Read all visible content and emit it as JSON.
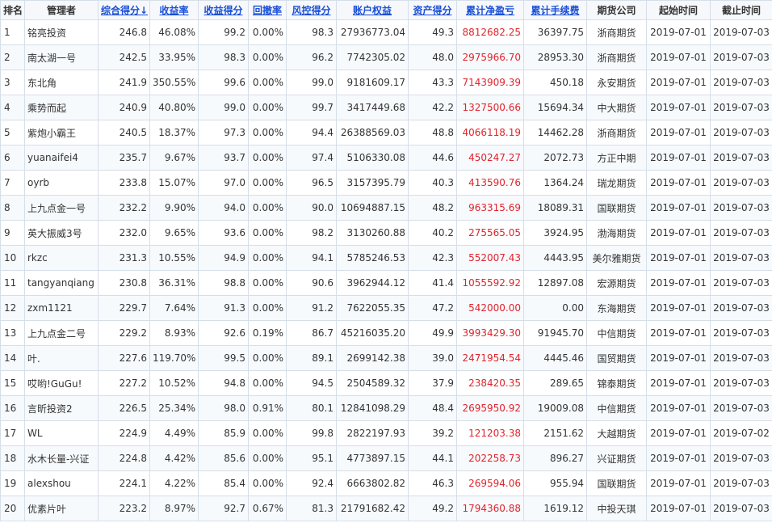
{
  "headers": [
    {
      "label": "排名",
      "sortable": false
    },
    {
      "label": "管理者",
      "sortable": false
    },
    {
      "label": "综合得分↓",
      "sortable": true
    },
    {
      "label": "收益率",
      "sortable": true
    },
    {
      "label": "收益得分",
      "sortable": true
    },
    {
      "label": "回撤率",
      "sortable": true
    },
    {
      "label": "风控得分",
      "sortable": true
    },
    {
      "label": "账户权益",
      "sortable": true
    },
    {
      "label": "资产得分",
      "sortable": true
    },
    {
      "label": "累计净盈亏",
      "sortable": true
    },
    {
      "label": "累计手续费",
      "sortable": true
    },
    {
      "label": "期货公司",
      "sortable": false
    },
    {
      "label": "起始时间",
      "sortable": false
    },
    {
      "label": "截止时间",
      "sortable": false
    }
  ],
  "rows": [
    [
      "1",
      "铭亮投资",
      "246.8",
      "46.08%",
      "99.2",
      "0.00%",
      "98.3",
      "27936773.04",
      "49.3",
      "8812682.25",
      "36397.75",
      "浙商期货",
      "2019-07-01",
      "2019-07-03"
    ],
    [
      "2",
      "南太湖一号",
      "242.5",
      "33.95%",
      "98.3",
      "0.00%",
      "96.2",
      "7742305.02",
      "48.0",
      "2975966.70",
      "28953.30",
      "浙商期货",
      "2019-07-01",
      "2019-07-03"
    ],
    [
      "3",
      "东北角",
      "241.9",
      "350.55%",
      "99.6",
      "0.00%",
      "99.0",
      "9181609.17",
      "43.3",
      "7143909.39",
      "450.18",
      "永安期货",
      "2019-07-01",
      "2019-07-03"
    ],
    [
      "4",
      "乘势而起",
      "240.9",
      "40.80%",
      "99.0",
      "0.00%",
      "99.7",
      "3417449.68",
      "42.2",
      "1327500.66",
      "15694.34",
      "中大期货",
      "2019-07-01",
      "2019-07-03"
    ],
    [
      "5",
      "紫炮小霸王",
      "240.5",
      "18.37%",
      "97.3",
      "0.00%",
      "94.4",
      "26388569.03",
      "48.8",
      "4066118.19",
      "14462.28",
      "浙商期货",
      "2019-07-01",
      "2019-07-03"
    ],
    [
      "6",
      "yuanaifei4",
      "235.7",
      "9.67%",
      "93.7",
      "0.00%",
      "97.4",
      "5106330.08",
      "44.6",
      "450247.27",
      "2072.73",
      "方正中期",
      "2019-07-01",
      "2019-07-03"
    ],
    [
      "7",
      "oyrb",
      "233.8",
      "15.07%",
      "97.0",
      "0.00%",
      "96.5",
      "3157395.79",
      "40.3",
      "413590.76",
      "1364.24",
      "瑞龙期货",
      "2019-07-01",
      "2019-07-03"
    ],
    [
      "8",
      "上九点金一号",
      "232.2",
      "9.90%",
      "94.0",
      "0.00%",
      "90.0",
      "10694887.15",
      "48.2",
      "963315.69",
      "18089.31",
      "国联期货",
      "2019-07-01",
      "2019-07-03"
    ],
    [
      "9",
      "英大振威3号",
      "232.0",
      "9.65%",
      "93.6",
      "0.00%",
      "98.2",
      "3130260.88",
      "40.2",
      "275565.05",
      "3924.95",
      "渤海期货",
      "2019-07-01",
      "2019-07-03"
    ],
    [
      "10",
      "rkzc",
      "231.3",
      "10.55%",
      "94.9",
      "0.00%",
      "94.1",
      "5785246.53",
      "42.3",
      "552007.43",
      "4443.95",
      "美尔雅期货",
      "2019-07-01",
      "2019-07-03"
    ],
    [
      "11",
      "tangyanqiang",
      "230.8",
      "36.31%",
      "98.8",
      "0.00%",
      "90.6",
      "3962944.12",
      "41.4",
      "1055592.92",
      "12897.08",
      "宏源期货",
      "2019-07-01",
      "2019-07-03"
    ],
    [
      "12",
      "zxm1121",
      "229.7",
      "7.64%",
      "91.3",
      "0.00%",
      "91.2",
      "7622055.35",
      "47.2",
      "542000.00",
      "0.00",
      "东海期货",
      "2019-07-01",
      "2019-07-03"
    ],
    [
      "13",
      "上九点金二号",
      "229.2",
      "8.93%",
      "92.6",
      "0.19%",
      "86.7",
      "45216035.20",
      "49.9",
      "3993429.30",
      "91945.70",
      "中信期货",
      "2019-07-01",
      "2019-07-03"
    ],
    [
      "14",
      "叶.",
      "227.6",
      "119.70%",
      "99.5",
      "0.00%",
      "89.1",
      "2699142.38",
      "39.0",
      "2471954.54",
      "4445.46",
      "国贸期货",
      "2019-07-01",
      "2019-07-03"
    ],
    [
      "15",
      "哎哟!GuGu!",
      "227.2",
      "10.52%",
      "94.8",
      "0.00%",
      "94.5",
      "2504589.32",
      "37.9",
      "238420.35",
      "289.65",
      "锦泰期货",
      "2019-07-01",
      "2019-07-03"
    ],
    [
      "16",
      "言昕投资2",
      "226.5",
      "25.34%",
      "98.0",
      "0.91%",
      "80.1",
      "12841098.29",
      "48.4",
      "2695950.92",
      "19009.08",
      "中信期货",
      "2019-07-01",
      "2019-07-03"
    ],
    [
      "17",
      "WL",
      "224.9",
      "4.49%",
      "85.9",
      "0.00%",
      "99.8",
      "2822197.93",
      "39.2",
      "121203.38",
      "2151.62",
      "大越期货",
      "2019-07-01",
      "2019-07-02"
    ],
    [
      "18",
      "水木长量-兴证",
      "224.8",
      "4.42%",
      "85.6",
      "0.00%",
      "95.1",
      "4773897.15",
      "44.1",
      "202258.73",
      "896.27",
      "兴证期货",
      "2019-07-01",
      "2019-07-03"
    ],
    [
      "19",
      "alexshou",
      "224.1",
      "4.22%",
      "85.4",
      "0.00%",
      "92.4",
      "6663802.82",
      "46.3",
      "269594.06",
      "955.94",
      "国联期货",
      "2019-07-01",
      "2019-07-03"
    ],
    [
      "20",
      "优素片叶",
      "223.2",
      "8.97%",
      "92.7",
      "0.67%",
      "81.3",
      "21791682.42",
      "49.2",
      "1794360.88",
      "1619.12",
      "中投天琪",
      "2019-07-01",
      "2019-07-03"
    ]
  ],
  "colors": {
    "link": "#1a4fd6",
    "profit": "#e0242c",
    "border": "#d6dee8"
  }
}
